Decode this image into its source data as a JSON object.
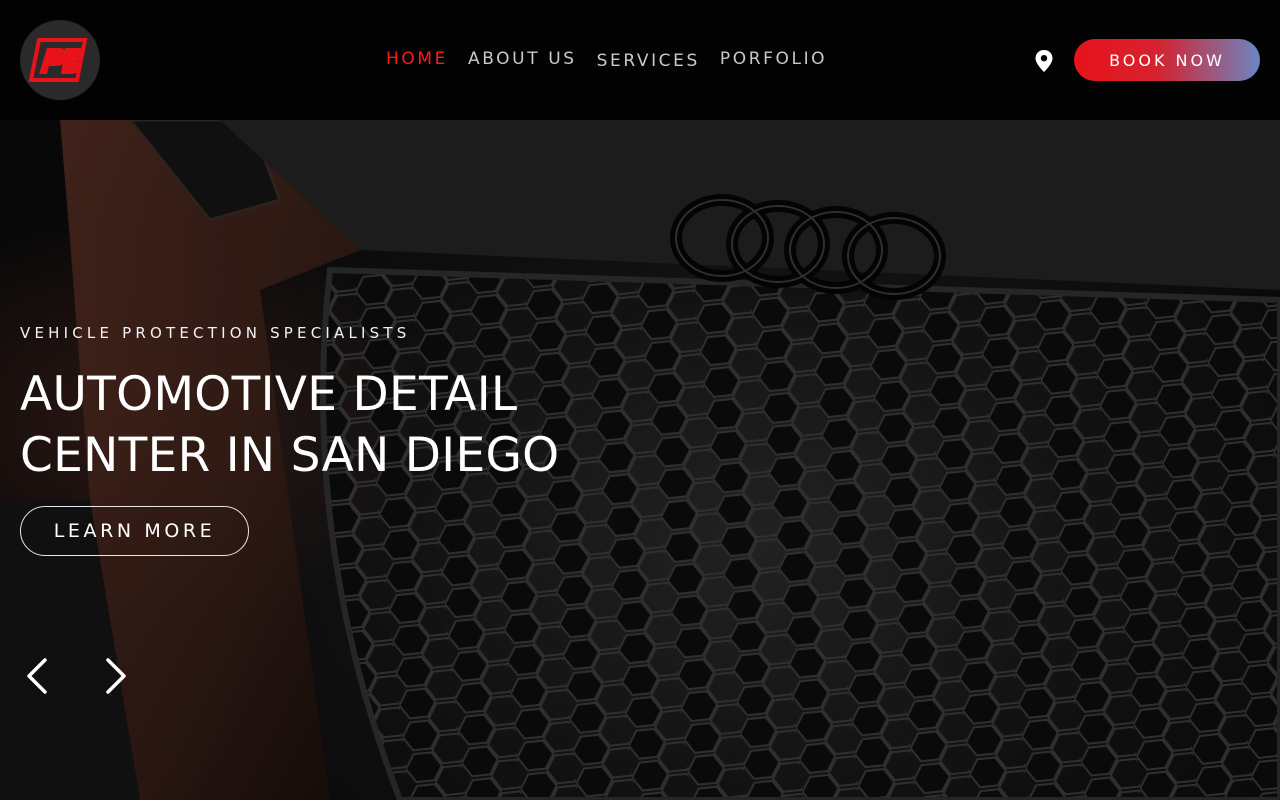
{
  "header": {
    "logo_alt": "logo",
    "nav": [
      {
        "label": "HOME",
        "active": true
      },
      {
        "label": "ABOUT US",
        "active": false
      },
      {
        "label": "SERVICES",
        "active": false
      },
      {
        "label": "PORFOLIO",
        "active": false
      }
    ],
    "book_label": "BOOK NOW",
    "location_icon": "map-pin-icon"
  },
  "hero": {
    "eyebrow": "VEHICLE PROTECTION SPECIALISTS",
    "headline_line1": "AUTOMOTIVE DETAIL",
    "headline_line2": "CENTER IN SAN DIEGO",
    "cta_label": "LEARN MORE",
    "prev_icon": "chevron-left-icon",
    "next_icon": "chevron-right-icon"
  },
  "colors": {
    "accent_red": "#ff1a1a",
    "button_gradient_start": "#e8121a",
    "button_gradient_end": "#6b86c2",
    "nav_text": "#c9c9c9",
    "background": "#030303"
  }
}
